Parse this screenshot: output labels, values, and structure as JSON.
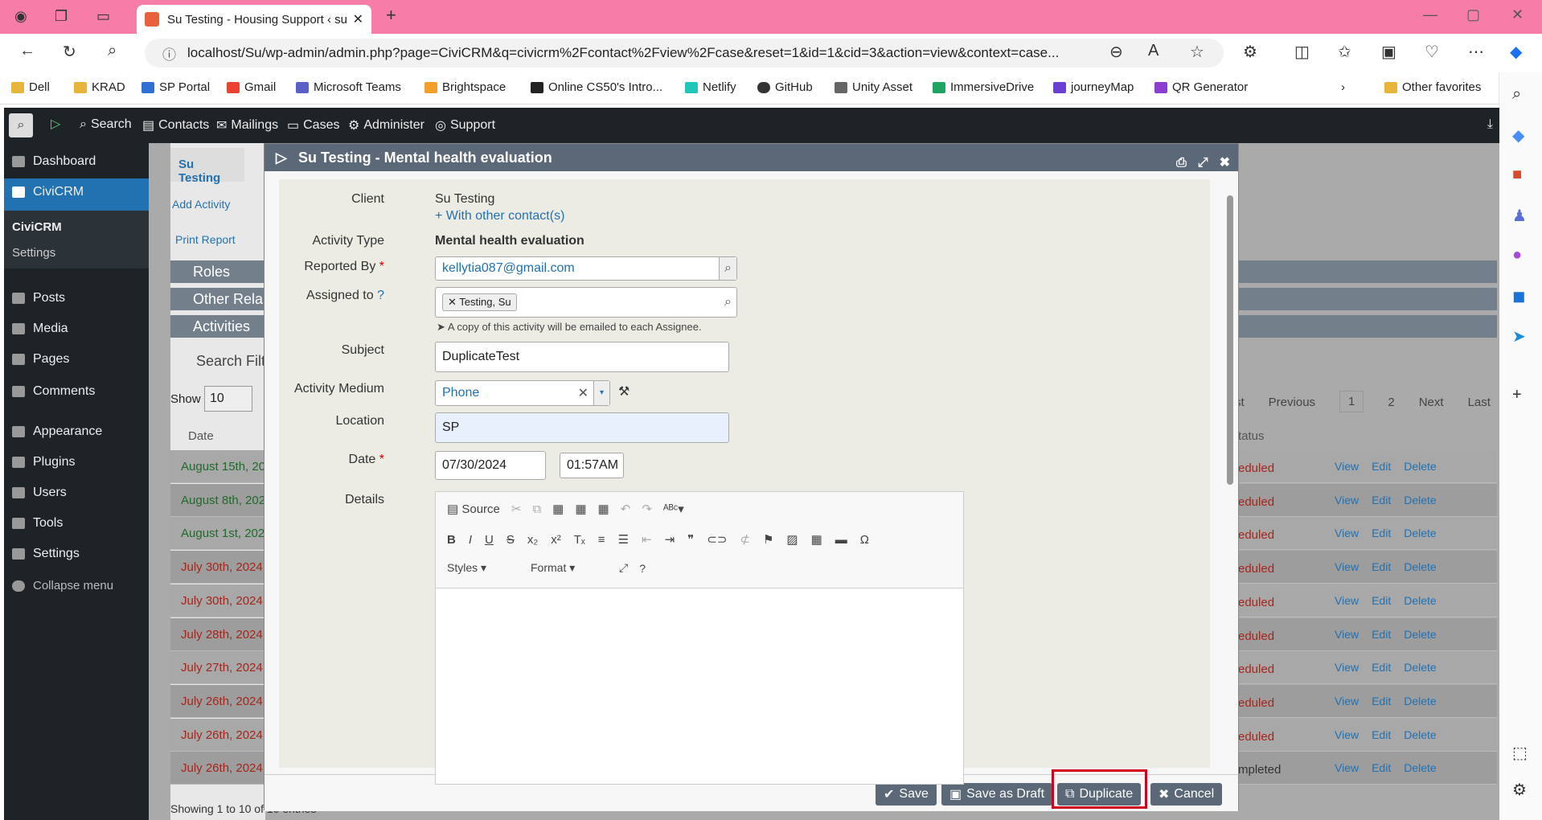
{
  "browser": {
    "tab_title": "Su Testing - Housing Support ‹ su",
    "url": "localhost/Su/wp-admin/admin.php?page=CiviCRM&q=civicrm%2Fcontact%2Fview%2Fcase&reset=1&id=1&cid=3&action=view&context=case...",
    "bookmarks": [
      "Dell",
      "KRAD",
      "SP Portal",
      "Gmail",
      "Microsoft Teams",
      "Brightspace",
      "Online CS50's Intro...",
      "Netlify",
      "GitHub",
      "Unity Asset",
      "ImmersiveDrive",
      "journeyMap",
      "QR Generator",
      "Other favorites"
    ]
  },
  "wp_menu": [
    "Search",
    "Contacts",
    "Mailings",
    "Cases",
    "Administer",
    "Support"
  ],
  "sidebar": {
    "items": [
      "Dashboard",
      "CiviCRM",
      "CiviCRM",
      "Settings",
      "Posts",
      "Media",
      "Pages",
      "Comments",
      "Appearance",
      "Plugins",
      "Users",
      "Tools",
      "Settings",
      "Collapse menu"
    ]
  },
  "background": {
    "tab": "Su Testing",
    "add_activity": "Add Activity",
    "print_report": "Print Report",
    "roles": "Roles",
    "other_relations": "Other Rela",
    "activities": "Activities",
    "search_filters": "Search Filt",
    "show": "Show",
    "show_value": "10",
    "date_header": "Date",
    "status_header": "tatus",
    "pagination": [
      "st",
      "Previous",
      "1",
      "2",
      "Next",
      "Last"
    ],
    "rows": [
      {
        "date": "August 15th, 20",
        "status": "eduled"
      },
      {
        "date": "August 8th, 202",
        "status": "eduled"
      },
      {
        "date": "August 1st, 202",
        "status": "eduled"
      },
      {
        "date": "July 30th, 2024",
        "status": "eduled"
      },
      {
        "date": "July 30th, 2024",
        "status": "eduled"
      },
      {
        "date": "July 28th, 2024",
        "status": "eduled"
      },
      {
        "date": "July 27th, 2024",
        "status": "eduled"
      },
      {
        "date": "July 26th, 2024",
        "status": "eduled"
      },
      {
        "date": "July 26th, 2024",
        "status": "eduled"
      },
      {
        "date": "July 26th, 2024",
        "status": "mpleted"
      }
    ],
    "row_links": [
      "View",
      "Edit",
      "Delete"
    ],
    "footer": "Showing 1 to 10 of 10 entries"
  },
  "modal": {
    "title": "Su Testing - Mental health evaluation",
    "client_label": "Client",
    "client": "Su Testing",
    "other_contacts": "With other contact(s)",
    "activity_type_label": "Activity Type",
    "activity_type": "Mental health evaluation",
    "reported_by_label": "Reported By",
    "reported_by": "kellytia087@gmail.com",
    "assigned_label": "Assigned to",
    "assigned": "Testing, Su",
    "assign_note": "A copy of this activity will be emailed to each Assignee.",
    "subject_label": "Subject",
    "subject": "DuplicateTest",
    "medium_label": "Activity Medium",
    "medium": "Phone",
    "location_label": "Location",
    "location": "SP",
    "date_label": "Date",
    "date": "07/30/2024",
    "time": "01:57AM",
    "details_label": "Details",
    "source": "Source",
    "styles": "Styles",
    "format": "Format",
    "buttons": {
      "save": "Save",
      "draft": "Save as Draft",
      "duplicate": "Duplicate",
      "cancel": "Cancel"
    }
  }
}
